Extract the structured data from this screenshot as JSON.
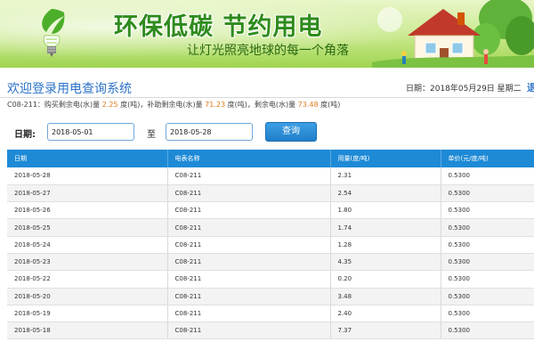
{
  "banner": {
    "slogan": "环保低碳  节约用电",
    "subslogan": "让灯光照亮地球的每一个角落"
  },
  "header": {
    "title": "欢迎登录用电查询系统",
    "date_info": "日期：2018年05月29日 星期二",
    "logout": "退"
  },
  "balance": {
    "label": "C08-211：",
    "bought_prefix": "购买剩余电(水)量 ",
    "bought": "2.25",
    "bought_unit": " 度(吨)，",
    "subsidy_prefix": "补助剩余电(水)量 ",
    "subsidy": "71.23",
    "subsidy_unit": " 度(吨)，",
    "remaining_prefix": "剩余电(水)量 ",
    "remaining": "73.48",
    "remaining_unit": " 度(吨)"
  },
  "filter": {
    "date_label": "日期:",
    "start_date": "2018-05-01",
    "to_label": "至",
    "end_date": "2018-05-28",
    "query_label": "查询"
  },
  "table": {
    "headers": [
      "日期",
      "电表名称",
      "用量(度/吨)",
      "单价(元/度/吨)"
    ],
    "rows": [
      [
        "2018-05-28",
        "C08-211",
        "2.31",
        "0.5300"
      ],
      [
        "2018-05-27",
        "C08-211",
        "2.54",
        "0.5300"
      ],
      [
        "2018-05-26",
        "C08-211",
        "1.80",
        "0.5300"
      ],
      [
        "2018-05-25",
        "C08-211",
        "1.74",
        "0.5300"
      ],
      [
        "2018-05-24",
        "C08-211",
        "1.28",
        "0.5300"
      ],
      [
        "2018-05-23",
        "C08-211",
        "4.35",
        "0.5300"
      ],
      [
        "2018-05-22",
        "C08-211",
        "0.20",
        "0.5300"
      ],
      [
        "2018-05-20",
        "C08-211",
        "3.48",
        "0.5300"
      ],
      [
        "2018-05-19",
        "C08-211",
        "2.40",
        "0.5300"
      ],
      [
        "2018-05-18",
        "C08-211",
        "7.37",
        "0.5300"
      ]
    ]
  },
  "colors": {
    "accent": "#1e8ad6",
    "highlight": "#e07b1a",
    "title": "#2e74c8",
    "banner_text": "#2e8b1c"
  },
  "icons": {
    "banner_left": "eco-bulb-icon",
    "banner_right": "house-illustration"
  }
}
